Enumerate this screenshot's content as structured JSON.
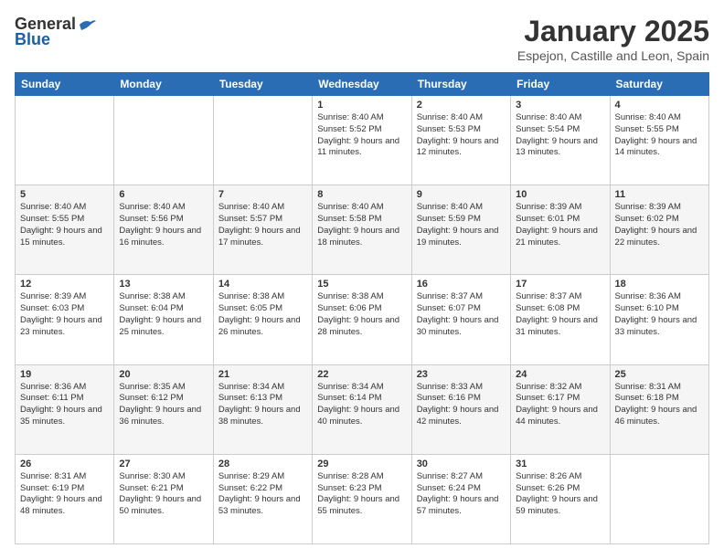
{
  "logo": {
    "general": "General",
    "blue": "Blue"
  },
  "header": {
    "month": "January 2025",
    "location": "Espejon, Castille and Leon, Spain"
  },
  "weekdays": [
    "Sunday",
    "Monday",
    "Tuesday",
    "Wednesday",
    "Thursday",
    "Friday",
    "Saturday"
  ],
  "weeks": [
    [
      {
        "day": "",
        "text": ""
      },
      {
        "day": "",
        "text": ""
      },
      {
        "day": "",
        "text": ""
      },
      {
        "day": "1",
        "text": "Sunrise: 8:40 AM\nSunset: 5:52 PM\nDaylight: 9 hours and 11 minutes."
      },
      {
        "day": "2",
        "text": "Sunrise: 8:40 AM\nSunset: 5:53 PM\nDaylight: 9 hours and 12 minutes."
      },
      {
        "day": "3",
        "text": "Sunrise: 8:40 AM\nSunset: 5:54 PM\nDaylight: 9 hours and 13 minutes."
      },
      {
        "day": "4",
        "text": "Sunrise: 8:40 AM\nSunset: 5:55 PM\nDaylight: 9 hours and 14 minutes."
      }
    ],
    [
      {
        "day": "5",
        "text": "Sunrise: 8:40 AM\nSunset: 5:55 PM\nDaylight: 9 hours and 15 minutes."
      },
      {
        "day": "6",
        "text": "Sunrise: 8:40 AM\nSunset: 5:56 PM\nDaylight: 9 hours and 16 minutes."
      },
      {
        "day": "7",
        "text": "Sunrise: 8:40 AM\nSunset: 5:57 PM\nDaylight: 9 hours and 17 minutes."
      },
      {
        "day": "8",
        "text": "Sunrise: 8:40 AM\nSunset: 5:58 PM\nDaylight: 9 hours and 18 minutes."
      },
      {
        "day": "9",
        "text": "Sunrise: 8:40 AM\nSunset: 5:59 PM\nDaylight: 9 hours and 19 minutes."
      },
      {
        "day": "10",
        "text": "Sunrise: 8:39 AM\nSunset: 6:01 PM\nDaylight: 9 hours and 21 minutes."
      },
      {
        "day": "11",
        "text": "Sunrise: 8:39 AM\nSunset: 6:02 PM\nDaylight: 9 hours and 22 minutes."
      }
    ],
    [
      {
        "day": "12",
        "text": "Sunrise: 8:39 AM\nSunset: 6:03 PM\nDaylight: 9 hours and 23 minutes."
      },
      {
        "day": "13",
        "text": "Sunrise: 8:38 AM\nSunset: 6:04 PM\nDaylight: 9 hours and 25 minutes."
      },
      {
        "day": "14",
        "text": "Sunrise: 8:38 AM\nSunset: 6:05 PM\nDaylight: 9 hours and 26 minutes."
      },
      {
        "day": "15",
        "text": "Sunrise: 8:38 AM\nSunset: 6:06 PM\nDaylight: 9 hours and 28 minutes."
      },
      {
        "day": "16",
        "text": "Sunrise: 8:37 AM\nSunset: 6:07 PM\nDaylight: 9 hours and 30 minutes."
      },
      {
        "day": "17",
        "text": "Sunrise: 8:37 AM\nSunset: 6:08 PM\nDaylight: 9 hours and 31 minutes."
      },
      {
        "day": "18",
        "text": "Sunrise: 8:36 AM\nSunset: 6:10 PM\nDaylight: 9 hours and 33 minutes."
      }
    ],
    [
      {
        "day": "19",
        "text": "Sunrise: 8:36 AM\nSunset: 6:11 PM\nDaylight: 9 hours and 35 minutes."
      },
      {
        "day": "20",
        "text": "Sunrise: 8:35 AM\nSunset: 6:12 PM\nDaylight: 9 hours and 36 minutes."
      },
      {
        "day": "21",
        "text": "Sunrise: 8:34 AM\nSunset: 6:13 PM\nDaylight: 9 hours and 38 minutes."
      },
      {
        "day": "22",
        "text": "Sunrise: 8:34 AM\nSunset: 6:14 PM\nDaylight: 9 hours and 40 minutes."
      },
      {
        "day": "23",
        "text": "Sunrise: 8:33 AM\nSunset: 6:16 PM\nDaylight: 9 hours and 42 minutes."
      },
      {
        "day": "24",
        "text": "Sunrise: 8:32 AM\nSunset: 6:17 PM\nDaylight: 9 hours and 44 minutes."
      },
      {
        "day": "25",
        "text": "Sunrise: 8:31 AM\nSunset: 6:18 PM\nDaylight: 9 hours and 46 minutes."
      }
    ],
    [
      {
        "day": "26",
        "text": "Sunrise: 8:31 AM\nSunset: 6:19 PM\nDaylight: 9 hours and 48 minutes."
      },
      {
        "day": "27",
        "text": "Sunrise: 8:30 AM\nSunset: 6:21 PM\nDaylight: 9 hours and 50 minutes."
      },
      {
        "day": "28",
        "text": "Sunrise: 8:29 AM\nSunset: 6:22 PM\nDaylight: 9 hours and 53 minutes."
      },
      {
        "day": "29",
        "text": "Sunrise: 8:28 AM\nSunset: 6:23 PM\nDaylight: 9 hours and 55 minutes."
      },
      {
        "day": "30",
        "text": "Sunrise: 8:27 AM\nSunset: 6:24 PM\nDaylight: 9 hours and 57 minutes."
      },
      {
        "day": "31",
        "text": "Sunrise: 8:26 AM\nSunset: 6:26 PM\nDaylight: 9 hours and 59 minutes."
      },
      {
        "day": "",
        "text": ""
      }
    ]
  ]
}
